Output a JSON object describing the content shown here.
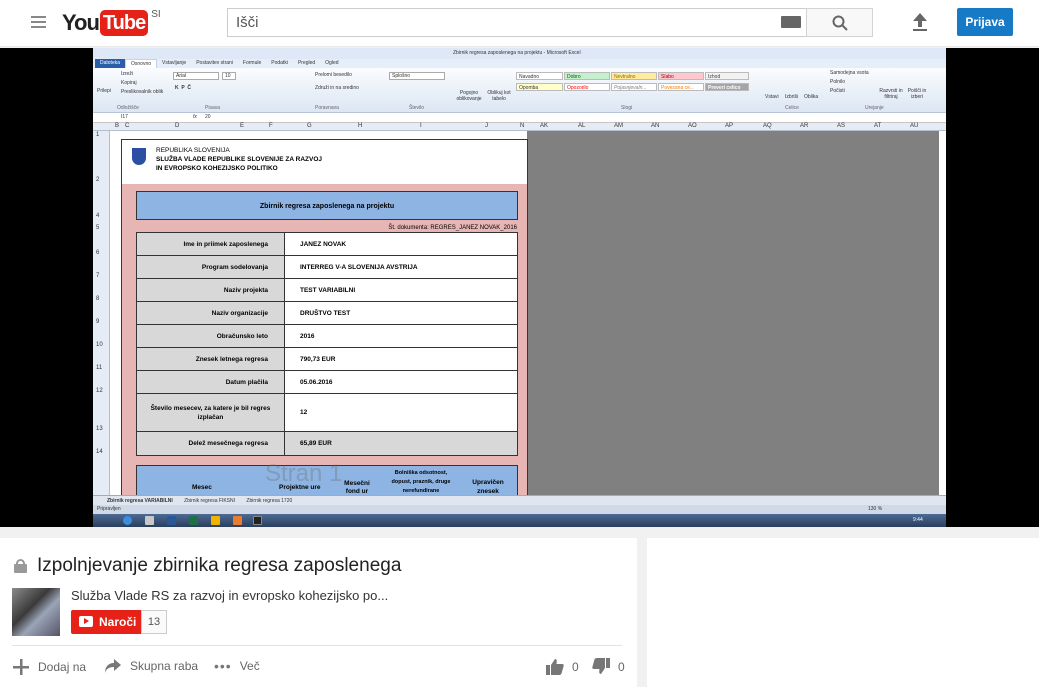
{
  "header": {
    "logo_you": "You",
    "logo_tube": "Tube",
    "logo_country": "SI",
    "search_placeholder": "Išči",
    "signin_label": "Prijava"
  },
  "excel": {
    "window_title": "Zbirnik regresa zaposlenega na projektu - Microsoft Excel",
    "ribbon_tabs": [
      "Datoteka",
      "Osnovno",
      "Vstavljanje",
      "Postavitev strani",
      "Formule",
      "Podatki",
      "Pregled",
      "Ogled"
    ],
    "ribbon": {
      "clipboard": {
        "cut": "Izreži",
        "copy": "Kopiraj",
        "painter": "Preslikovalnik oblik",
        "paste": "Prilepi",
        "group": "Odložišče"
      },
      "font": {
        "name": "Arial",
        "size": "10",
        "group": "Pisava"
      },
      "alignment": {
        "wrap": "Prelomi besedilo",
        "merge": "Združi in na sredino",
        "group": "Poravnava"
      },
      "number": {
        "format": "Splošno",
        "group": "Število"
      },
      "styles": {
        "cond": "Pogojno oblikovanje",
        "astable": "Oblikuj kot tabelo",
        "normal": "Navadno",
        "good": "Dobro",
        "neutral": "Nevtralno",
        "bad": "Slabo",
        "output": "Izhod",
        "note": "Opomba",
        "warning": "Opozorilo",
        "explanatory": "Pojasnjevaln...",
        "linked": "Povezana ce...",
        "check": "Preveri celico",
        "group": "Slogi"
      },
      "cells": {
        "insert": "Vstavi",
        "delete": "Izbriši",
        "format": "Oblika",
        "group": "Celice"
      },
      "editing": {
        "autosum": "Samodejna vsota",
        "fill": "Polnilo",
        "clear": "Počisti",
        "sort": "Razvrsti in filtriraj",
        "find": "Poišči in izberi",
        "group": "Urejanje"
      }
    },
    "name_box": "I17",
    "formula_value": "20",
    "columns": [
      "B",
      "C",
      "D",
      "E",
      "F",
      "G",
      "H",
      "I",
      "J",
      "N",
      "AK",
      "AL",
      "AM",
      "AN",
      "AO",
      "AP",
      "AQ",
      "AR",
      "AS",
      "AT",
      "AU"
    ],
    "rows": [
      "1",
      "2",
      "4",
      "5",
      "6",
      "7",
      "8",
      "9",
      "10",
      "11",
      "12",
      "13",
      "14"
    ],
    "doc": {
      "org_line1": "REPUBLIKA SLOVENIJA",
      "org_line2": "SLUŽBA VLADE REPUBLIKE SLOVENIJE ZA RAZVOJ",
      "org_line3": "IN EVROPSKO KOHEZIJSKO POLITIKO",
      "title": "Zbirnik regresa zaposlenega na projektu",
      "doc_number": "Št. dokumenta: REGRES_JANEZ NOVAK_2016",
      "fields": [
        {
          "label": "Ime in priimek zaposlenega",
          "value": "JANEZ NOVAK"
        },
        {
          "label": "Program sodelovanja",
          "value": "INTERREG V-A SLOVENIJA AVSTRIJA"
        },
        {
          "label": "Naziv projekta",
          "value": "TEST VARIABILNI"
        },
        {
          "label": "Naziv organizacije",
          "value": "DRUŠTVO TEST"
        },
        {
          "label": "Obračunsko leto",
          "value": "2016"
        },
        {
          "label": "Znesek letnega regresa",
          "value": "790,73 EUR"
        },
        {
          "label": "Datum plačila",
          "value": "05.06.2016"
        }
      ],
      "months_field": {
        "label": "Število mesecev, za katere je bil regres izplačan",
        "value": "12"
      },
      "monthly_share": {
        "label": "Delež mesečnega regresa",
        "value": "65,89 EUR"
      },
      "bottom_header": {
        "month": "Mesec",
        "hours": "Projektne ure",
        "fund": "Mesečni fond ur",
        "absence": "Bolniška odsotnost, dopust, praznik, druge nerefundirane",
        "eligible": "Upravičen znesek"
      },
      "watermark": "Stran 1"
    },
    "sheets": [
      "Zbirnik regresa VARIABILNI",
      "Zbirnik regresa FIKSNI",
      "Zbirnik regresa 1720"
    ],
    "status": "Pripravljen",
    "zoom": "130 %",
    "clock": "9:44"
  },
  "video": {
    "title": "Izpolnjevanje zbirnika regresa zaposlenega",
    "channel": "Služba Vlade RS za razvoj in evropsko kohezijsko po...",
    "subscribe_label": "Naroči",
    "subscriber_count": "13",
    "actions": {
      "add": "Dodaj na",
      "share": "Skupna raba",
      "more": "Več"
    },
    "likes": "0",
    "dislikes": "0"
  }
}
